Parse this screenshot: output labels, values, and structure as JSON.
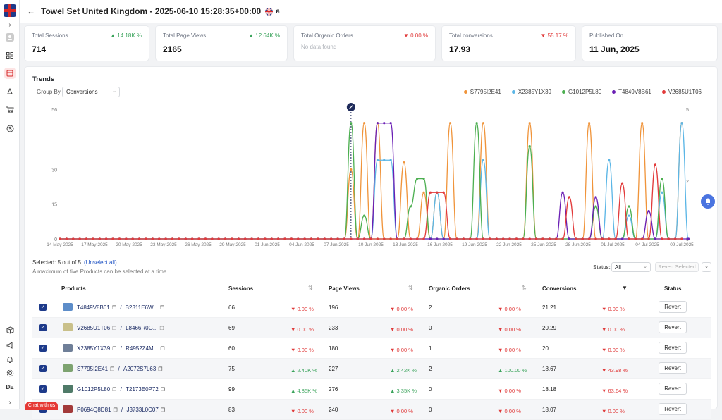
{
  "header": {
    "title": "Towel Set United Kingdom - 2025-06-10 15:28:35+00:00",
    "amazon_label": "a"
  },
  "sidebar": {
    "bottom_label": "DE",
    "icons": [
      "user-icon",
      "grid-icon",
      "box-icon",
      "rocket-icon",
      "cart-icon",
      "dollar-icon",
      "package-icon",
      "megaphone-icon",
      "bell-icon",
      "gear-icon"
    ]
  },
  "cards": [
    {
      "label": "Total Sessions",
      "value": "714",
      "change": "14.18K %",
      "direction": "up"
    },
    {
      "label": "Total Page Views",
      "value": "2165",
      "change": "12.64K %",
      "direction": "up"
    },
    {
      "label": "Total Organic Orders",
      "value": "",
      "sub": "No data found",
      "change": "0.00 %",
      "direction": "down"
    },
    {
      "label": "Total conversions",
      "value": "17.93",
      "change": "55.17 %",
      "direction": "down"
    },
    {
      "label": "Published On",
      "value": "11 Jun, 2025"
    }
  ],
  "trends": {
    "title": "Trends",
    "group_by_label": "Group By",
    "group_by_value": "Conversions"
  },
  "chart_data": {
    "type": "line",
    "left_ticks": [
      "56",
      "30",
      "15",
      "0"
    ],
    "right_ticks": [
      "5",
      "2",
      "0"
    ],
    "x_ticks": [
      "14 May 2025",
      "17 May 2025",
      "20 May 2025",
      "23 May 2025",
      "26 May 2025",
      "29 May 2025",
      "01 Jun 2025",
      "04 Jun 2025",
      "07 Jun 2025",
      "10 Jun 2025",
      "13 Jun 2025",
      "16 Jun 2025",
      "19 Jun 2025",
      "22 Jun 2025",
      "25 Jun 2025",
      "28 Jun 2025",
      "01 Jul 2025",
      "04 Jul 2025",
      "09 Jul 2025"
    ],
    "series": [
      {
        "name": "S7795I2E41",
        "color": "#f0943a",
        "values": [
          0,
          0,
          0,
          0,
          0,
          0,
          0,
          0,
          0,
          0,
          0,
          0,
          0,
          0,
          0,
          0,
          0,
          0,
          0,
          0,
          0,
          0,
          0,
          0,
          0,
          0,
          0,
          0,
          0,
          0,
          0,
          0,
          0,
          0,
          0,
          0,
          0,
          0,
          0,
          0,
          0,
          0,
          0,
          0,
          30,
          0,
          50,
          0,
          50,
          0,
          0,
          0,
          33,
          0,
          0,
          20,
          0,
          20,
          0,
          50,
          0,
          0,
          0,
          0,
          50,
          0,
          0,
          0,
          0,
          0,
          0,
          50,
          0,
          0,
          0,
          0,
          0,
          0,
          0,
          0,
          50,
          0,
          0,
          0,
          0,
          0,
          0,
          0,
          50,
          0,
          0,
          0,
          0,
          0,
          50
        ]
      },
      {
        "name": "X2385Y1X39",
        "color": "#5bb6e6",
        "values": [
          0,
          0,
          0,
          0,
          0,
          0,
          0,
          0,
          0,
          0,
          0,
          0,
          0,
          0,
          0,
          0,
          0,
          0,
          0,
          0,
          0,
          0,
          0,
          0,
          0,
          0,
          0,
          0,
          0,
          0,
          0,
          0,
          0,
          0,
          0,
          0,
          0,
          0,
          0,
          0,
          0,
          0,
          0,
          0,
          0,
          0,
          0,
          0,
          34,
          34,
          34,
          0,
          0,
          0,
          0,
          0,
          0,
          20,
          0,
          0,
          0,
          0,
          0,
          0,
          34,
          0,
          0,
          0,
          0,
          0,
          0,
          0,
          0,
          0,
          0,
          0,
          0,
          0,
          0,
          0,
          0,
          0,
          0,
          34,
          0,
          0,
          10,
          0,
          0,
          0,
          0,
          20,
          0,
          0,
          50,
          0
        ]
      },
      {
        "name": "G1012P5L80",
        "color": "#4caf50",
        "values": [
          0,
          0,
          0,
          0,
          0,
          0,
          0,
          0,
          0,
          0,
          0,
          0,
          0,
          0,
          0,
          0,
          0,
          0,
          0,
          0,
          0,
          0,
          0,
          0,
          0,
          0,
          0,
          0,
          0,
          0,
          0,
          0,
          0,
          0,
          0,
          0,
          0,
          0,
          0,
          0,
          0,
          0,
          0,
          0,
          50,
          0,
          10,
          0,
          0,
          0,
          0,
          0,
          0,
          14,
          26,
          26,
          0,
          0,
          0,
          0,
          0,
          0,
          0,
          50,
          0,
          0,
          0,
          0,
          0,
          0,
          0,
          40,
          0,
          0,
          0,
          0,
          0,
          0,
          0,
          0,
          0,
          14,
          0,
          0,
          0,
          0,
          14,
          0,
          0,
          0,
          0,
          26,
          0,
          0,
          0
        ]
      },
      {
        "name": "T4849V8B61",
        "color": "#6a1fb4",
        "values": [
          0,
          0,
          0,
          0,
          0,
          0,
          0,
          0,
          0,
          0,
          0,
          0,
          0,
          0,
          0,
          0,
          0,
          0,
          0,
          0,
          0,
          0,
          0,
          0,
          0,
          0,
          0,
          0,
          0,
          0,
          0,
          0,
          0,
          0,
          0,
          0,
          0,
          0,
          0,
          0,
          0,
          0,
          0,
          0,
          0,
          0,
          0,
          0,
          50,
          50,
          50,
          0,
          0,
          0,
          0,
          0,
          0,
          0,
          0,
          0,
          0,
          0,
          0,
          0,
          0,
          0,
          0,
          0,
          0,
          0,
          0,
          0,
          0,
          0,
          0,
          0,
          20,
          0,
          0,
          0,
          0,
          18,
          0,
          0,
          0,
          0,
          0,
          0,
          0,
          12,
          0,
          0,
          0,
          0,
          0,
          0
        ]
      },
      {
        "name": "V2685U1T06",
        "color": "#e23a3a",
        "values": [
          0,
          0,
          0,
          0,
          0,
          0,
          0,
          0,
          0,
          0,
          0,
          0,
          0,
          0,
          0,
          0,
          0,
          0,
          0,
          0,
          0,
          0,
          0,
          0,
          0,
          0,
          0,
          0,
          0,
          0,
          0,
          0,
          0,
          0,
          0,
          0,
          0,
          0,
          0,
          0,
          0,
          0,
          0,
          0,
          0,
          0,
          0,
          0,
          0,
          0,
          0,
          0,
          0,
          0,
          0,
          0,
          20,
          20,
          20,
          0,
          0,
          0,
          0,
          0,
          0,
          0,
          0,
          0,
          0,
          0,
          0,
          0,
          0,
          0,
          0,
          0,
          0,
          18,
          0,
          0,
          0,
          0,
          0,
          0,
          0,
          24,
          0,
          0,
          0,
          0,
          32,
          0,
          0,
          0,
          0
        ]
      }
    ]
  },
  "selection": {
    "selected_text": "Selected: 5 out of 5",
    "unselect_label": "(Unselect all)",
    "max_note": "A maximum of five Products can be selected at a time"
  },
  "filters": {
    "status_label": "Status:",
    "status_value": "All",
    "revert_selected_label": "Revert Selected"
  },
  "table": {
    "headers": [
      "Products",
      "Sessions",
      "Page Views",
      "Organic Orders",
      "Conversions",
      "Status"
    ],
    "rows": [
      {
        "asin": "T4849V8B61",
        "sku": "B2311E6W...",
        "sessions": "66",
        "sessions_chg": "0.00 %",
        "sessions_dir": "down",
        "views": "196",
        "views_chg": "0.00 %",
        "views_dir": "down",
        "orders": "2",
        "orders_chg": "0.00 %",
        "orders_dir": "down",
        "conv": "21.21",
        "conv_chg": "0.00 %",
        "conv_dir": "down",
        "status": "Revert",
        "thumb": "#5d8dc9"
      },
      {
        "asin": "V2685U1T06",
        "sku": "L8466R0G...",
        "sessions": "69",
        "sessions_chg": "0.00 %",
        "sessions_dir": "down",
        "views": "233",
        "views_chg": "0.00 %",
        "views_dir": "down",
        "orders": "0",
        "orders_chg": "0.00 %",
        "orders_dir": "down",
        "conv": "20.29",
        "conv_chg": "0.00 %",
        "conv_dir": "down",
        "status": "Revert",
        "thumb": "#c9c08a"
      },
      {
        "asin": "X2385Y1X39",
        "sku": "R4952Z4M...",
        "sessions": "60",
        "sessions_chg": "0.00 %",
        "sessions_dir": "down",
        "views": "180",
        "views_chg": "0.00 %",
        "views_dir": "down",
        "orders": "1",
        "orders_chg": "0.00 %",
        "orders_dir": "down",
        "conv": "20",
        "conv_chg": "0.00 %",
        "conv_dir": "down",
        "status": "Revert",
        "thumb": "#6f7f98"
      },
      {
        "asin": "S7795I2E41",
        "sku": "A2072S7L63",
        "sessions": "75",
        "sessions_chg": "2.40K %",
        "sessions_dir": "up",
        "views": "227",
        "views_chg": "2.42K %",
        "views_dir": "up",
        "orders": "2",
        "orders_chg": "100.00 %",
        "orders_dir": "up",
        "conv": "18.67",
        "conv_chg": "43.98 %",
        "conv_dir": "down",
        "status": "Revert",
        "thumb": "#7da370"
      },
      {
        "asin": "G1012P5L80",
        "sku": "T2173E0P72",
        "sessions": "99",
        "sessions_chg": "4.85K %",
        "sessions_dir": "up",
        "views": "276",
        "views_chg": "3.35K %",
        "views_dir": "up",
        "orders": "0",
        "orders_chg": "0.00 %",
        "orders_dir": "down",
        "conv": "18.18",
        "conv_chg": "63.64 %",
        "conv_dir": "down",
        "status": "Revert",
        "thumb": "#4f7a68"
      },
      {
        "asin": "P0694Q8D81",
        "sku": "J3733L0C07",
        "sessions": "83",
        "sessions_chg": "0.00 %",
        "sessions_dir": "down",
        "views": "240",
        "views_chg": "0.00 %",
        "views_dir": "down",
        "orders": "0",
        "orders_chg": "0.00 %",
        "orders_dir": "down",
        "conv": "18.07",
        "conv_chg": "0.00 %",
        "conv_dir": "down",
        "status": "Revert",
        "thumb": "#a33a3a"
      }
    ]
  },
  "chat": {
    "label": "Chat with us"
  }
}
